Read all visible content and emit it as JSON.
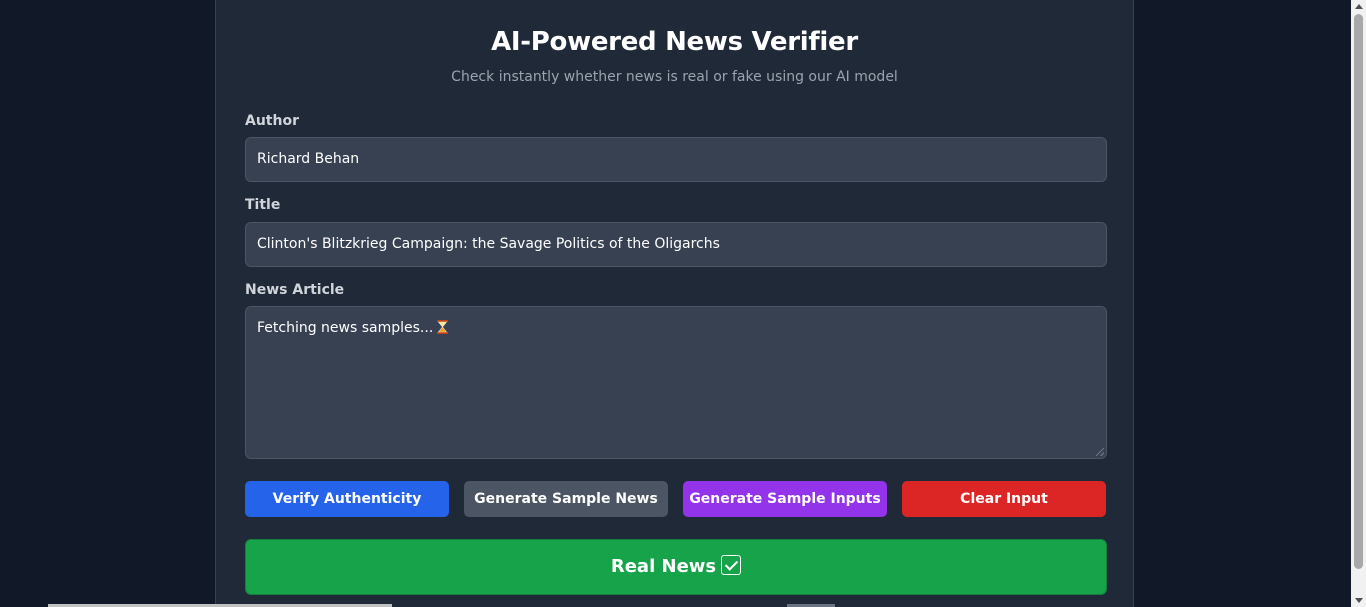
{
  "header": {
    "title": "AI-Powered News Verifier",
    "subtitle": "Check instantly whether news is real or fake using our AI model"
  },
  "form": {
    "author_label": "Author",
    "author_value": "Richard Behan",
    "title_label": "Title",
    "title_value": "Clinton's Blitzkrieg Campaign: the Savage Politics of the Oligarchs",
    "article_label": "News Article",
    "article_value": "Fetching news samples..."
  },
  "buttons": {
    "verify": "Verify Authenticity",
    "sample_news": "Generate Sample News",
    "sample_inputs": "Generate Sample Inputs",
    "clear": "Clear Input"
  },
  "result": {
    "label": "Real News",
    "icon": "check-mark-icon"
  },
  "colors": {
    "background": "#111827",
    "card": "#1f2937",
    "verify": "#2563eb",
    "sample_news": "#4b5563",
    "sample_inputs": "#9333ea",
    "clear": "#dc2626",
    "result": "#16a34a"
  }
}
